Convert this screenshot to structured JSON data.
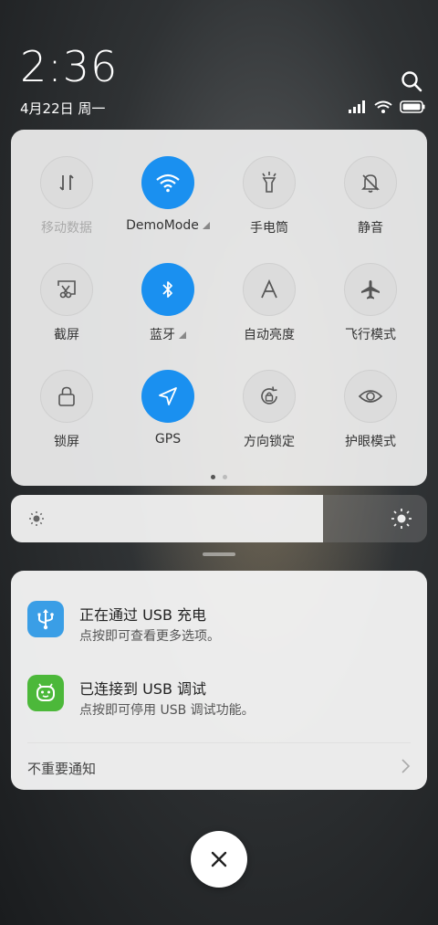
{
  "status": {
    "time": "2:36",
    "date": "4月22日 周一"
  },
  "quick_settings": {
    "tiles": [
      {
        "label": "移动数据",
        "icon": "mobile-data-icon",
        "on": false
      },
      {
        "label": "DemoMode",
        "icon": "wifi-icon",
        "on": true
      },
      {
        "label": "手电筒",
        "icon": "flashlight-icon",
        "on": false
      },
      {
        "label": "静音",
        "icon": "bell-off-icon",
        "on": false
      },
      {
        "label": "截屏",
        "icon": "screenshot-icon",
        "on": false
      },
      {
        "label": "蓝牙",
        "icon": "bluetooth-icon",
        "on": true
      },
      {
        "label": "自动亮度",
        "icon": "auto-brightness-icon",
        "on": false
      },
      {
        "label": "飞行模式",
        "icon": "airplane-icon",
        "on": false
      },
      {
        "label": "锁屏",
        "icon": "lock-icon",
        "on": false
      },
      {
        "label": "GPS",
        "icon": "gps-icon",
        "on": true
      },
      {
        "label": "方向锁定",
        "icon": "rotation-lock-icon",
        "on": false
      },
      {
        "label": "护眼模式",
        "icon": "eye-icon",
        "on": false
      }
    ],
    "page_count": 2,
    "current_page": 1
  },
  "brightness": {
    "level": 0.75
  },
  "notifications": [
    {
      "title": "正在通过 USB 充电",
      "body": "点按即可查看更多选项。",
      "icon": "usb-icon",
      "color": "#3a9ee6"
    },
    {
      "title": "已连接到 USB 调试",
      "body": "点按即可停用 USB 调试功能。",
      "icon": "android-icon",
      "color": "#4cb83a"
    }
  ],
  "unimportant_label": "不重要通知",
  "colors": {
    "accent": "#1a90f0"
  }
}
